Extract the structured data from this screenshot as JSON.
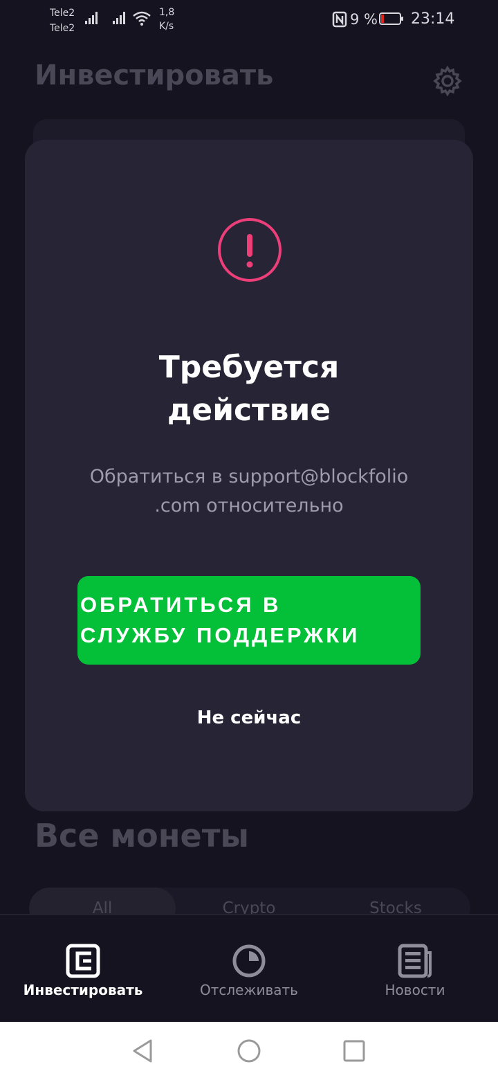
{
  "status_bar": {
    "carrier_1": "Tele2",
    "carrier_2": "Tele2",
    "speed_value": "1,8",
    "speed_unit": "K/s",
    "battery_percent": "9 %",
    "time": "23:14"
  },
  "page": {
    "title": "Инвестировать",
    "section_title": "Все монеты",
    "filters": [
      "All",
      "Crypto",
      "Stocks"
    ]
  },
  "modal": {
    "title_line_1": "Требуется",
    "title_line_2": "действие",
    "body_line_1": "Обратиться в support@blockfolio",
    "body_line_2": ".com относительно",
    "cta_line_1": "ОБРАТИТЬСЯ В",
    "cta_line_2": "СЛУЖБУ ПОДДЕРЖКИ",
    "dismiss_label": "Не сейчас"
  },
  "bottom_nav": {
    "items": [
      {
        "label": "Инвестировать",
        "icon": "invest-icon",
        "active": true
      },
      {
        "label": "Отслеживать",
        "icon": "pie-clock-icon",
        "active": false
      },
      {
        "label": "Новости",
        "icon": "news-icon",
        "active": false
      }
    ]
  },
  "colors": {
    "accent_pink": "#ec3f7a",
    "cta_green": "#04c038",
    "modal_bg": "#272535",
    "page_bg": "#15131f"
  }
}
